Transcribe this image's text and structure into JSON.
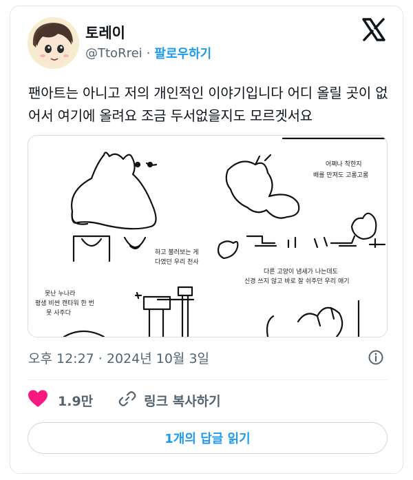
{
  "author": {
    "display_name": "토레이",
    "handle": "@TtoRrei",
    "separator": "·",
    "follow_label": "팔로우하기"
  },
  "tweet": {
    "text": "팬아트는 아니고 저의 개인적인 이야기입니다 어디 올릴 곳이 없어서 여기에 올려요 조금 두서없을지도 모르겟서요"
  },
  "media": {
    "captions": {
      "top_right_line1": "어쩌나 착한지",
      "top_right_line2": "배를 만져도 고롱고롱",
      "middle_line1": "하고 불러보는 게",
      "middle_line2": "다였던 우리 천사",
      "right_line1": "다른 고양이 냄새가 나는데도",
      "right_line2": "신경 쓰지 않고 바로 잘 쉬주던 우리 애기",
      "left_line1": "못난 누나라",
      "left_line2": "평생 비싼 캔타워 한 번",
      "left_line3": "못 사주다"
    }
  },
  "meta": {
    "timestamp": "오후 12:27 · 2024년 10월 3일"
  },
  "actions": {
    "like_count": "1.9만",
    "copy_link_label": "링크 복사하기",
    "read_replies_label": "1개의 답글 읽기"
  },
  "colors": {
    "accent": "#1d9bf0",
    "like": "#f91880",
    "muted": "#536471"
  }
}
